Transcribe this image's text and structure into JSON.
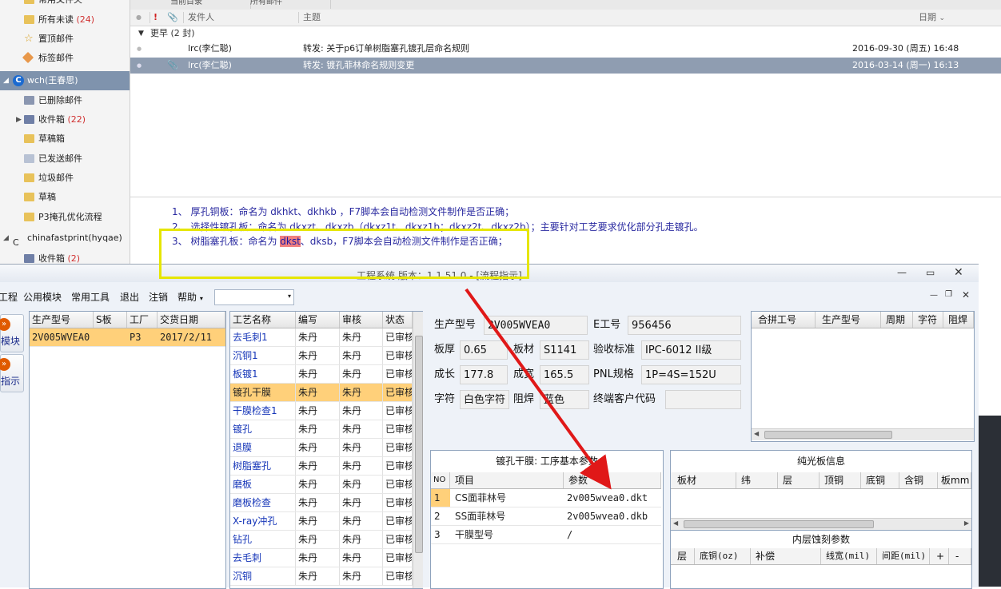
{
  "mail": {
    "folders": [
      {
        "label": "常用文件夹",
        "count": "",
        "icon": "folder-icon"
      },
      {
        "label": "所有未读",
        "count": "(24)",
        "icon": "folder-icon"
      },
      {
        "label": "置顶邮件",
        "count": "",
        "icon": "star-icon"
      },
      {
        "label": "标签邮件",
        "count": "",
        "icon": "tag-icon"
      },
      {
        "label": "wch(王春思)",
        "count": "",
        "icon": "account-icon"
      },
      {
        "label": "已删除邮件",
        "count": "",
        "icon": "trash-icon"
      },
      {
        "label": "收件箱",
        "count": "(22)",
        "icon": "inbox-icon"
      },
      {
        "label": "草稿箱",
        "count": "",
        "icon": "folder-icon"
      },
      {
        "label": "已发送邮件",
        "count": "",
        "icon": "sent-icon"
      },
      {
        "label": "垃圾邮件",
        "count": "",
        "icon": "folder-icon"
      },
      {
        "label": "草稿",
        "count": "",
        "icon": "folder-icon"
      },
      {
        "label": "P3掩孔优化流程",
        "count": "",
        "icon": "folder-icon"
      },
      {
        "label": "chinafastprint(hyqae)",
        "count": "",
        "icon": "account-icon"
      },
      {
        "label": "收件箱",
        "count": "(2)",
        "icon": "inbox-icon"
      }
    ],
    "tabs": [
      "当前目录",
      "所有邮件"
    ],
    "list_header": {
      "flag": "!",
      "attach": "📎",
      "from": "发件人",
      "subject": "主题",
      "date": "日期"
    },
    "group": "更早 (2 封)",
    "messages": [
      {
        "from": "lrc(李仁聪)",
        "subject": "转发: 关于p6订单树脂塞孔镀孔层命名规则",
        "date": "2016-09-30 (周五) 16:48",
        "selected": false
      },
      {
        "from": "lrc(李仁聪)",
        "subject": "转发: 镀孔菲林命名规则变更",
        "date": "2016-03-14 (周一) 16:13",
        "selected": true
      }
    ],
    "preview": {
      "line1": "1、 厚孔铜板：命名为 dkhkt、dkhkb ，F7脚本会自动检测文件制作是否正确；",
      "line2": "2、 选择性镀孔板：命名为 dkxzt、dkxzb（dkxz1t、dkxz1b；dkxz2t、dkxz2b）；主要针对工艺要求优化部分孔走镀孔。",
      "line3_pre": "3、 树脂塞孔板：命名为 ",
      "line3_hl": "dkst",
      "line3_post": "、dksb，F7脚本会自动检测文件制作是否正确；"
    }
  },
  "eng": {
    "title": "工程系统    版本：1.1.51.0 - [流程指示]",
    "menu": [
      "工程",
      "公用模块",
      "常用工具",
      "退出",
      "注销",
      "帮助"
    ],
    "menu_dropdown_value": "",
    "side_buttons": [
      "模块",
      "指示"
    ],
    "jobs_header": [
      "生产型号",
      "S板",
      "工厂",
      "交货日期"
    ],
    "jobs": [
      [
        "2V005WVEA0",
        "",
        "P3",
        "2017/2/11"
      ]
    ],
    "process_header": [
      "工艺名称",
      "编写",
      "审核",
      "状态"
    ],
    "processes": [
      [
        "去毛刺1",
        "朱丹",
        "朱丹",
        "已审核"
      ],
      [
        "沉铜1",
        "朱丹",
        "朱丹",
        "已审核"
      ],
      [
        "板镀1",
        "朱丹",
        "朱丹",
        "已审核"
      ],
      [
        "镀孔干膜",
        "朱丹",
        "朱丹",
        "已审核"
      ],
      [
        "干膜检查1",
        "朱丹",
        "朱丹",
        "已审核"
      ],
      [
        "镀孔",
        "朱丹",
        "朱丹",
        "已审核"
      ],
      [
        "退膜",
        "朱丹",
        "朱丹",
        "已审核"
      ],
      [
        "树脂塞孔",
        "朱丹",
        "朱丹",
        "已审核"
      ],
      [
        "磨板",
        "朱丹",
        "朱丹",
        "已审核"
      ],
      [
        "磨板检查",
        "朱丹",
        "朱丹",
        "已审核"
      ],
      [
        "X-ray冲孔",
        "朱丹",
        "朱丹",
        "已审核"
      ],
      [
        "钻孔",
        "朱丹",
        "朱丹",
        "已审核"
      ],
      [
        "去毛刺",
        "朱丹",
        "朱丹",
        "已审核"
      ],
      [
        "沉铜",
        "朱丹",
        "朱丹",
        "已审核"
      ]
    ],
    "selected_process_index": 3,
    "info": {
      "model_label": "生产型号",
      "model_value": "2V005WVEA0",
      "e_label": "E工号",
      "e_value": "956456",
      "thick_label": "板厚",
      "thick_value": "0.65",
      "mat_label": "板材",
      "mat_value": "S1141",
      "std_label": "验收标准",
      "std_value": "IPC-6012 II级",
      "len_label": "成长",
      "len_value": "177.8",
      "wid_label": "成宽",
      "wid_value": "165.5",
      "pnl_label": "PNL规格",
      "pnl_value": "1P=4S=152U",
      "char_label": "字符",
      "char_value": "白色字符",
      "mask_label": "阻焊",
      "mask_value": "蓝色",
      "cust_label": "终端客户代码",
      "cust_value": ""
    },
    "combine_header": [
      "合拼工号",
      "生产型号",
      "周期",
      "字符",
      "阻焊"
    ],
    "params": {
      "title": "镀孔干膜: 工序基本参数",
      "header": [
        "NO",
        "项目",
        "参数"
      ],
      "rows": [
        [
          "1",
          "CS面菲林号",
          "2v005wvea0.dkt"
        ],
        [
          "2",
          "SS面菲林号",
          "2v005wvea0.dkb"
        ],
        [
          "3",
          "干膜型号",
          "/"
        ]
      ]
    },
    "pure_board": {
      "title": "纯光板信息",
      "header": [
        "板材",
        "纬",
        "层",
        "顶铜",
        "底铜",
        "含铜",
        "板mm"
      ]
    },
    "inner_etch": {
      "title": "内层蚀刻参数",
      "header": [
        "层",
        "底铜(oz)",
        "补偿",
        "线宽(mil)",
        "间距(mil)",
        "+",
        "-"
      ]
    }
  },
  "colors": {
    "highlight_box": "#e6e600",
    "arrow": "#e01818",
    "selected_row": "#ffd07a",
    "preview_text": "#2a2aa0"
  }
}
